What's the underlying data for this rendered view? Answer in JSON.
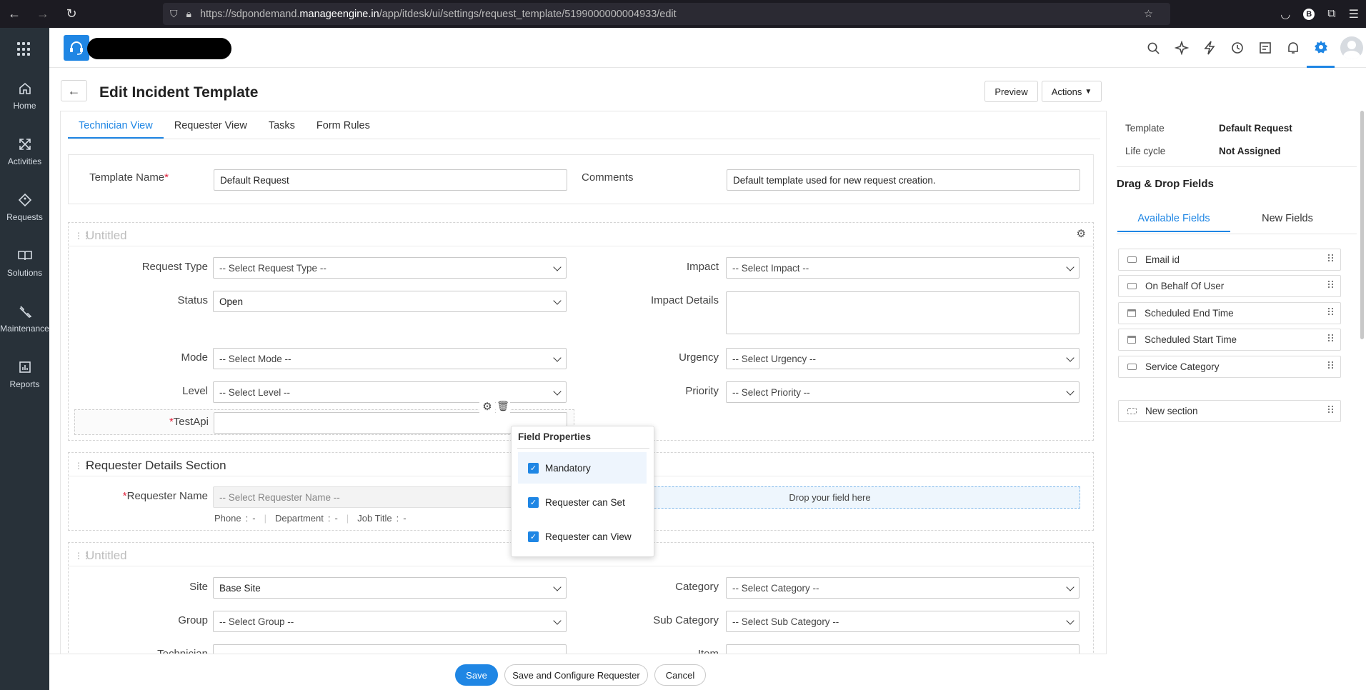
{
  "browser": {
    "url_prefix": "https://sdpondemand.",
    "url_host": "manageengine.in",
    "url_path": "/app/itdesk/ui/settings/request_template/5199000000004933/edit",
    "ext_badge": "B"
  },
  "sidebar": {
    "items": [
      {
        "label": "Home",
        "icon": "home-icon"
      },
      {
        "label": "Activities",
        "icon": "activities-icon"
      },
      {
        "label": "Requests",
        "icon": "requests-icon"
      },
      {
        "label": "Solutions",
        "icon": "solutions-icon"
      },
      {
        "label": "Maintenance",
        "icon": "maintenance-icon"
      },
      {
        "label": "Reports",
        "icon": "reports-icon"
      }
    ]
  },
  "page": {
    "title": "Edit Incident Template",
    "preview_label": "Preview",
    "actions_label": "Actions"
  },
  "tabs": [
    "Technician View",
    "Requester View",
    "Tasks",
    "Form Rules"
  ],
  "template_info": {
    "name_label": "Template Name",
    "name_value": "Default Request",
    "comments_label": "Comments",
    "comments_value": "Default template used for new request creation."
  },
  "section1": {
    "title": "Untitled",
    "request_type_label": "Request Type",
    "request_type_value": "-- Select Request Type --",
    "impact_label": "Impact",
    "impact_value": "-- Select Impact --",
    "status_label": "Status",
    "status_value": "Open",
    "impact_details_label": "Impact Details",
    "mode_label": "Mode",
    "mode_value": "-- Select Mode --",
    "urgency_label": "Urgency",
    "urgency_value": "-- Select Urgency --",
    "level_label": "Level",
    "level_value": "-- Select Level --",
    "priority_label": "Priority",
    "priority_value": "-- Select Priority --",
    "testapi_label": "TestApi"
  },
  "field_properties": {
    "title": "Field Properties",
    "options": [
      {
        "label": "Mandatory",
        "checked": true
      },
      {
        "label": "Requester can Set",
        "checked": true
      },
      {
        "label": "Requester can View",
        "checked": true
      }
    ]
  },
  "section2": {
    "title": "Requester Details Section",
    "requester_label": "Requester Name",
    "requester_value": "-- Select Requester Name --",
    "drop_text": "Drop your field here",
    "phone_label": "Phone",
    "phone_value": "-",
    "department_label": "Department",
    "department_value": "-",
    "job_title_label": "Job Title",
    "job_title_value": "-"
  },
  "section3": {
    "title": "Untitled",
    "site_label": "Site",
    "site_value": "Base Site",
    "category_label": "Category",
    "category_value": "-- Select Category --",
    "group_label": "Group",
    "group_value": "-- Select Group --",
    "subcategory_label": "Sub Category",
    "subcategory_value": "-- Select Sub Category --",
    "technician_label": "Technician",
    "item_label": "Item"
  },
  "right_panel": {
    "template_label": "Template",
    "template_value": "Default Request",
    "lifecycle_label": "Life cycle",
    "lifecycle_value": "Not Assigned",
    "heading": "Drag & Drop Fields",
    "tab_available": "Available Fields",
    "tab_new": "New Fields",
    "fields": [
      {
        "label": "Email id",
        "icon": "input-icon"
      },
      {
        "label": "On Behalf Of User",
        "icon": "input-icon"
      },
      {
        "label": "Scheduled End Time",
        "icon": "calendar-icon"
      },
      {
        "label": "Scheduled Start Time",
        "icon": "calendar-icon"
      },
      {
        "label": "Service Category",
        "icon": "input-icon"
      }
    ],
    "new_section": "New section"
  },
  "footer": {
    "save": "Save",
    "save_configure": "Save and Configure Requester",
    "cancel": "Cancel"
  },
  "colors": {
    "accent": "#1f86e4",
    "sidebar": "#283139",
    "mandatory": "#e0213b"
  }
}
